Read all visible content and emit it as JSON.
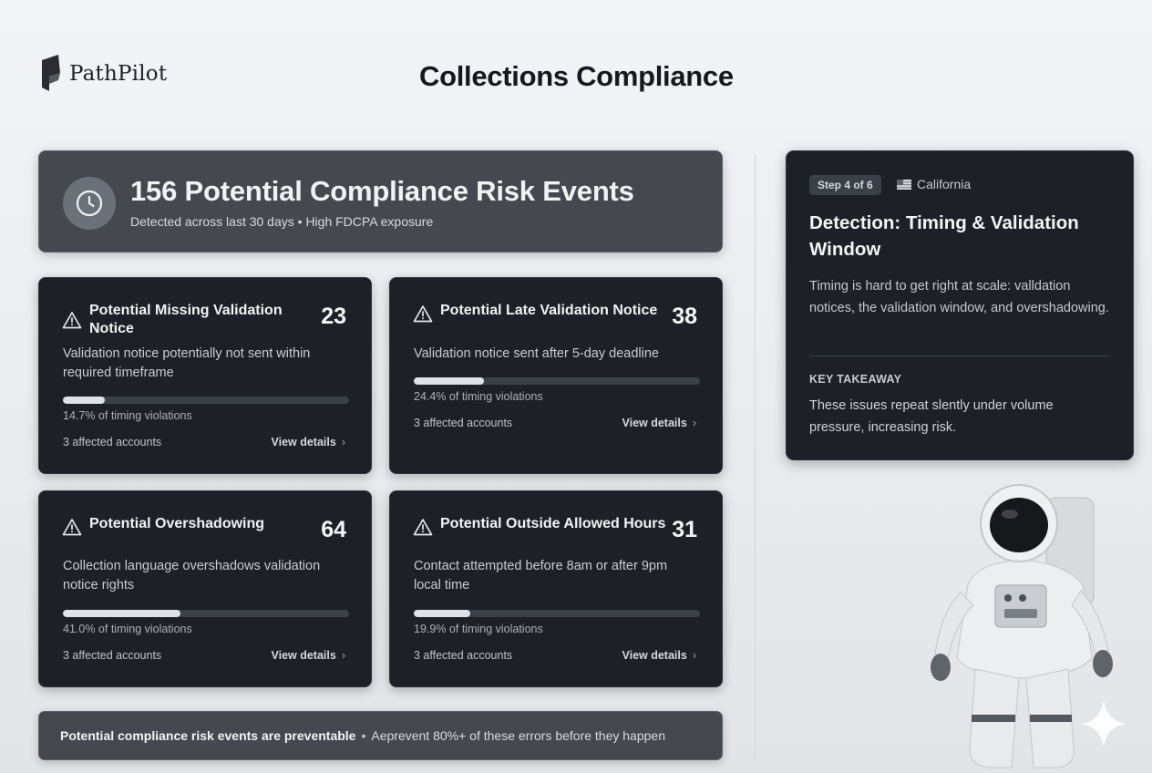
{
  "brand": {
    "name": "PathPilot"
  },
  "page": {
    "title": "Collections Compliance"
  },
  "hero": {
    "title": "156 Potential Compliance Risk Events",
    "subtitle": "Detected across last 30 days • High FDCPA exposure",
    "icon": "clock-icon"
  },
  "cards": [
    {
      "title": "Potential Missing Validation Notice",
      "count": "23",
      "description": "Validation notice potentially not sent within required timeframe",
      "progress_pct": 14.7,
      "pct_label": "14.7% of timing violations",
      "accounts": "3 affected accounts",
      "link": "View details"
    },
    {
      "title": "Potential Late Validation Notice",
      "count": "38",
      "description": "Validation notice sent after 5-day deadline",
      "progress_pct": 24.4,
      "pct_label": "24.4% of timing violations",
      "accounts": "3 affected accounts",
      "link": "View details"
    },
    {
      "title": "Potential Overshadowing",
      "count": "64",
      "description": "Collection language overshadows validation notice rights",
      "progress_pct": 41.0,
      "pct_label": "41.0% of timing violations",
      "accounts": "3 affected accounts",
      "link": "View details"
    },
    {
      "title": "Potential Outside Allowed Hours",
      "count": "31",
      "description": "Contact attempted before 8am or after 9pm local time",
      "progress_pct": 19.9,
      "pct_label": "19.9% of timing violations",
      "accounts": "3 affected accounts",
      "link": "View details"
    }
  ],
  "footer": {
    "strong": "Potential compliance risk events are preventable",
    "separator": "•",
    "text": "Aeprevent 80%+ of these errors before they happen"
  },
  "panel": {
    "step": "Step 4 of 6",
    "state": "California",
    "title": "Detection: Timing & Validation Window",
    "body": "Timing is hard to get right at scale: valldation notices, the validation window, and overshadowing.",
    "takeaway_label": "KEY TAKEAWAY",
    "takeaway_text": "These issues repeat slently under volume pressure, increasing risk."
  },
  "colors": {
    "card_bg": "#1d2026",
    "hero_bg": "#45494f",
    "bar_fill": "#dfe2e6",
    "bar_track": "#3c4149"
  }
}
